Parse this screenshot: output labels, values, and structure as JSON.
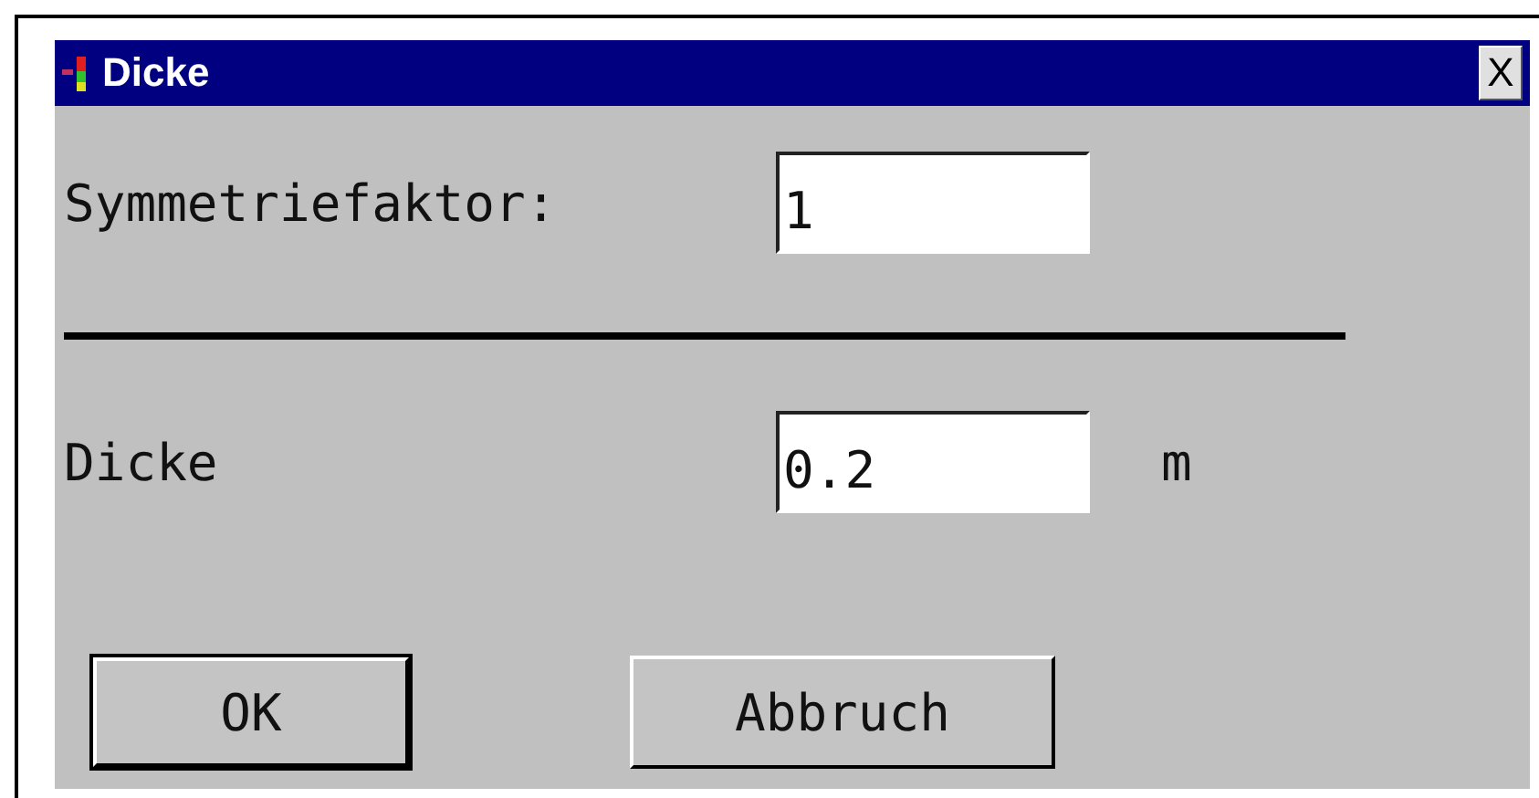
{
  "window": {
    "title": "Dicke",
    "close": "X"
  },
  "fields": [
    {
      "label": "Symmetriefaktor:",
      "value": "1"
    },
    {
      "label": "Dicke",
      "value": "0.2",
      "unit": "m"
    }
  ],
  "buttons": [
    {
      "label": "OK",
      "default": true
    },
    {
      "label": "Abbruch",
      "default": false
    }
  ]
}
